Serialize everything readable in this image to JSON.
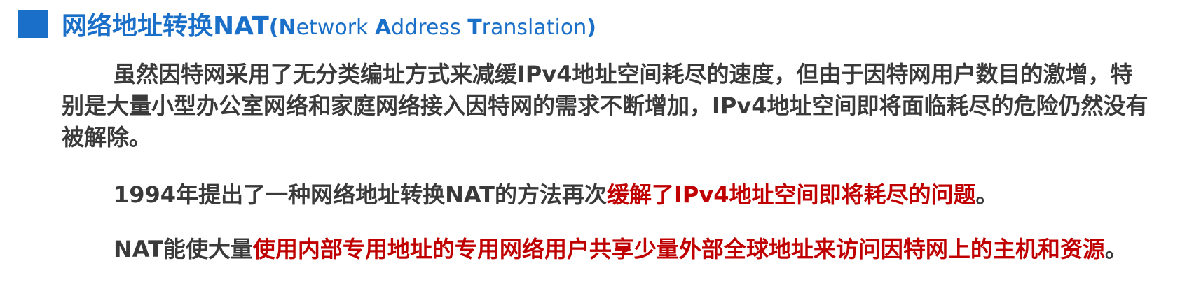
{
  "heading": {
    "zh": "网络地址转换NAT",
    "open_paren": "(",
    "en_n": "N",
    "en_etwork": "etwork ",
    "en_a": "A",
    "en_ddress": "ddress ",
    "en_t": "T",
    "en_ranslation": "ranslation",
    "close_paren": ")"
  },
  "paragraphs": {
    "p1": "虽然因特网采用了无分类编址方式来减缓IPv4地址空间耗尽的速度，但由于因特网用户数目的激增，特别是大量小型办公室网络和家庭网络接入因特网的需求不断增加，IPv4地址空间即将面临耗尽的危险仍然没有被解除。",
    "p2_normal": "1994年提出了一种网络地址转换NAT的方法再次",
    "p2_red": "缓解了IPv4地址空间即将耗尽的问题",
    "p2_end": "。",
    "p3_normal": "NAT能使大量",
    "p3_red": "使用内部专用地址的专用网络用户共享少量外部全球地址来访问因特网上的主机和资源",
    "p3_end": "。"
  },
  "colors": {
    "heading_blue": "#1a6fc8",
    "body_gray": "#3a3a3a",
    "highlight_red": "#c00000"
  }
}
